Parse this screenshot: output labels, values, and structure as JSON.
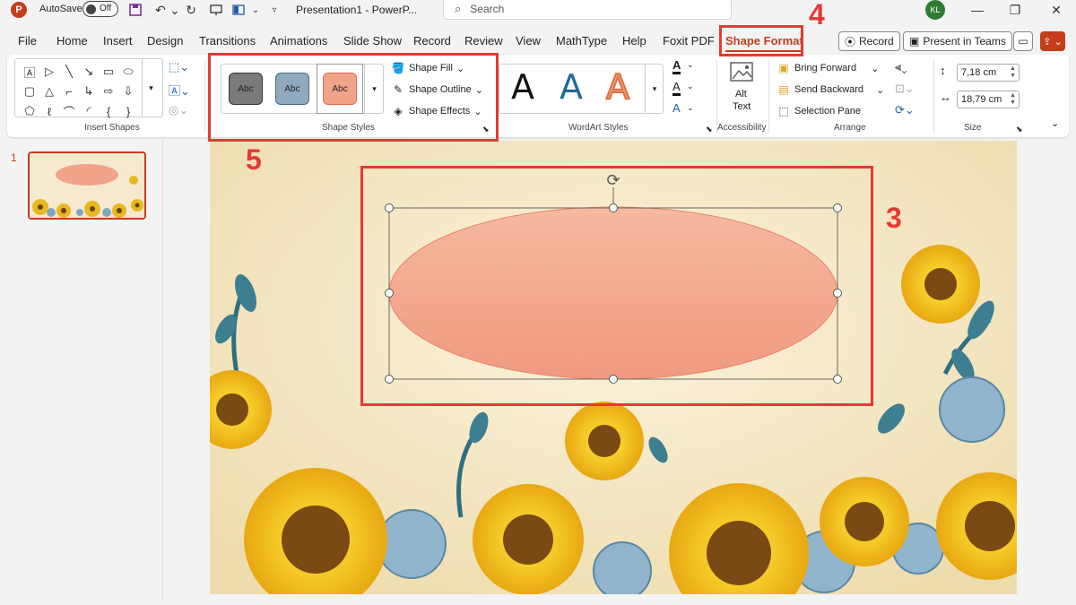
{
  "titlebar": {
    "app_logo": "P",
    "autosave_label": "AutoSave",
    "autosave_state": "Off",
    "doc_title": "Presentation1 - PowerP...",
    "search_placeholder": "Search",
    "user_initials": "KL",
    "icons": [
      "save-icon",
      "undo-icon",
      "redo-icon",
      "present-icon",
      "layout-icon",
      "customize-icon"
    ]
  },
  "tabs": [
    {
      "label": "File"
    },
    {
      "label": "Home"
    },
    {
      "label": "Insert"
    },
    {
      "label": "Design"
    },
    {
      "label": "Transitions"
    },
    {
      "label": "Animations"
    },
    {
      "label": "Slide Show"
    },
    {
      "label": "Record"
    },
    {
      "label": "Review"
    },
    {
      "label": "View"
    },
    {
      "label": "MathType"
    },
    {
      "label": "Help"
    },
    {
      "label": "Foxit PDF"
    },
    {
      "label": "Shape Format",
      "active": true
    }
  ],
  "actions": {
    "record_label": "Record",
    "present_teams_label": "Present in Teams"
  },
  "ribbon": {
    "insert_shapes": {
      "label": "Insert Shapes"
    },
    "shape_styles": {
      "label": "Shape Styles",
      "swatches": [
        {
          "text": "Abc",
          "fill": "#7a7a7a",
          "border": "#333333"
        },
        {
          "text": "Abc",
          "fill": "#8fa9bf",
          "border": "#4a6a85"
        },
        {
          "text": "Abc",
          "fill": "#f2a48a",
          "border": "#e06a4a",
          "selected": true
        }
      ],
      "fill_label": "Shape Fill",
      "outline_label": "Shape Outline",
      "effects_label": "Shape Effects"
    },
    "wordart_styles": {
      "label": "WordArt Styles",
      "letters": [
        {
          "text": "A",
          "color": "#111111"
        },
        {
          "text": "A",
          "color": "#1f6a9a"
        },
        {
          "text": "A",
          "color": "#f0a080"
        }
      ]
    },
    "accessibility": {
      "label": "Accessibility",
      "alt_text_line1": "Alt",
      "alt_text_line2": "Text"
    },
    "arrange": {
      "label": "Arrange",
      "bring_forward": "Bring Forward",
      "send_backward": "Send Backward",
      "selection_pane": "Selection Pane"
    },
    "size": {
      "label": "Size",
      "height": "7,18 cm",
      "width": "18,79 cm"
    }
  },
  "thumbnail": {
    "number": "1"
  },
  "annotations": [
    {
      "id": "slide-shape",
      "number": "3"
    },
    {
      "id": "shape-format-tab",
      "number": "4"
    },
    {
      "id": "shape-styles-group",
      "number": "5"
    }
  ],
  "colors": {
    "accent": "#c43e1c",
    "annotation": "#e53935",
    "oval_fill": "#f2a48a",
    "slide_bg": "#f4e8c8"
  }
}
